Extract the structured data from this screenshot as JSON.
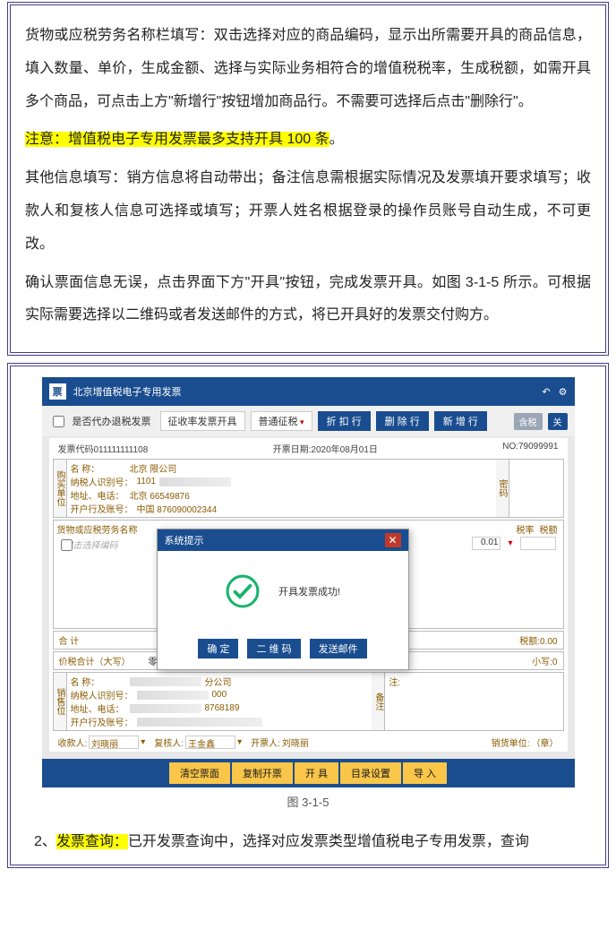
{
  "doc": {
    "p1": "货物或应税劳务名称栏填写：双击选择对应的商品编码，显示出所需要开具的商品信息，填入数量、单价，生成金额、选择与实际业务相符合的增值税税率，生成税额，如需开具多个商品，可点击上方\"新增行\"按钮增加商品行。不需要可选择后点击\"删除行\"。",
    "p2_hl": "注意：增值税电子专用发票最多支持开具 100 条",
    "p2_tail": "。",
    "p3": "其他信息填写：销方信息将自动带出；备注信息需根据实际情况及发票填开要求填写；收款人和复核人信息可选择或填写；开票人姓名根据登录的操作员账号自动生成，不可更改。",
    "p4": "确认票面信息无误，点击界面下方\"开具\"按钮，完成发票开具。如图 3-1-5 所示。可根据实际需要选择以二维码或者发送邮件的方式，将已开具好的发票交付购方。",
    "caption": "图 3-1-5",
    "foot_num": "2、",
    "foot_hl": "发票查询：",
    "foot_tail": "已开发票查询中，选择对应发票类型增值税电子专用发票，查询"
  },
  "app": {
    "logo": "票",
    "title": "北京增值税电子专用发票",
    "chk_refund": "是否代办退税发票",
    "tab1": "征收率发票开具",
    "tab2": "普通征税",
    "btn_discount": "折 扣 行",
    "btn_delete": "删 除 行",
    "btn_add": "新 增 行",
    "pill_tax": "含税",
    "pill_close": "关",
    "inv_code_lbl": "发票代码",
    "inv_code": "011111111108",
    "inv_date_lbl": "开票日期:",
    "inv_date": "2020年08月01日",
    "inv_no_lbl": "NO:",
    "inv_no": "79099991",
    "buyer_side": "购买单位",
    "pwd_side": "密码",
    "buyer_name_lbl": "名        称：",
    "buyer_name_val": "北京                    限公司",
    "buyer_tax_lbl": "纳税人识别号：",
    "buyer_tax_val": "1101",
    "buyer_addr_lbl": "地址、电话：",
    "buyer_addr_val": "北京                         66549876",
    "buyer_bank_lbl": "开户行及账号：",
    "buyer_bank_val": "中国                    876090002344",
    "tbl_h1": "货物或应税劳务名称",
    "tbl_h2": "税率",
    "tbl_h3": "税额",
    "tbl_hint": "双击选择编码",
    "rate_val": "0.01",
    "sum_lbl": "合   计",
    "sum_tax": "税额:0.00",
    "big_lbl": "价税合计（大写）",
    "big_val": "零圆整",
    "big_small": "小写:0",
    "seller_side": "销售位",
    "remark_side": "备注",
    "seller_name_lbl": "名        称：",
    "seller_name_val": "                    分公司",
    "seller_tax_lbl": "纳税人识别号：",
    "seller_tax_val": "                000",
    "seller_addr_lbl": "地址、电话：",
    "seller_addr_val": "                    8768189",
    "seller_bank_lbl": "开户行及账号：",
    "payee_lbl": "收款人:",
    "payee_val": "刘晓丽",
    "checker_lbl": "复核人:",
    "checker_val": "王金鑫",
    "drawer_lbl": "开票人:",
    "drawer_val": "刘晓丽",
    "seller_stamp_lbl": "销货单位:",
    "seller_stamp_val": "（章）",
    "dlg_title": "系统提示",
    "dlg_msg": "开具发票成功!",
    "dlg_ok": "确  定",
    "dlg_qr": "二 维 码",
    "dlg_mail": "发送邮件",
    "act_clear": "清空票面",
    "act_copy": "复制开票",
    "act_issue": "开  具",
    "act_catalog": "目录设置",
    "act_import": "导  入"
  }
}
